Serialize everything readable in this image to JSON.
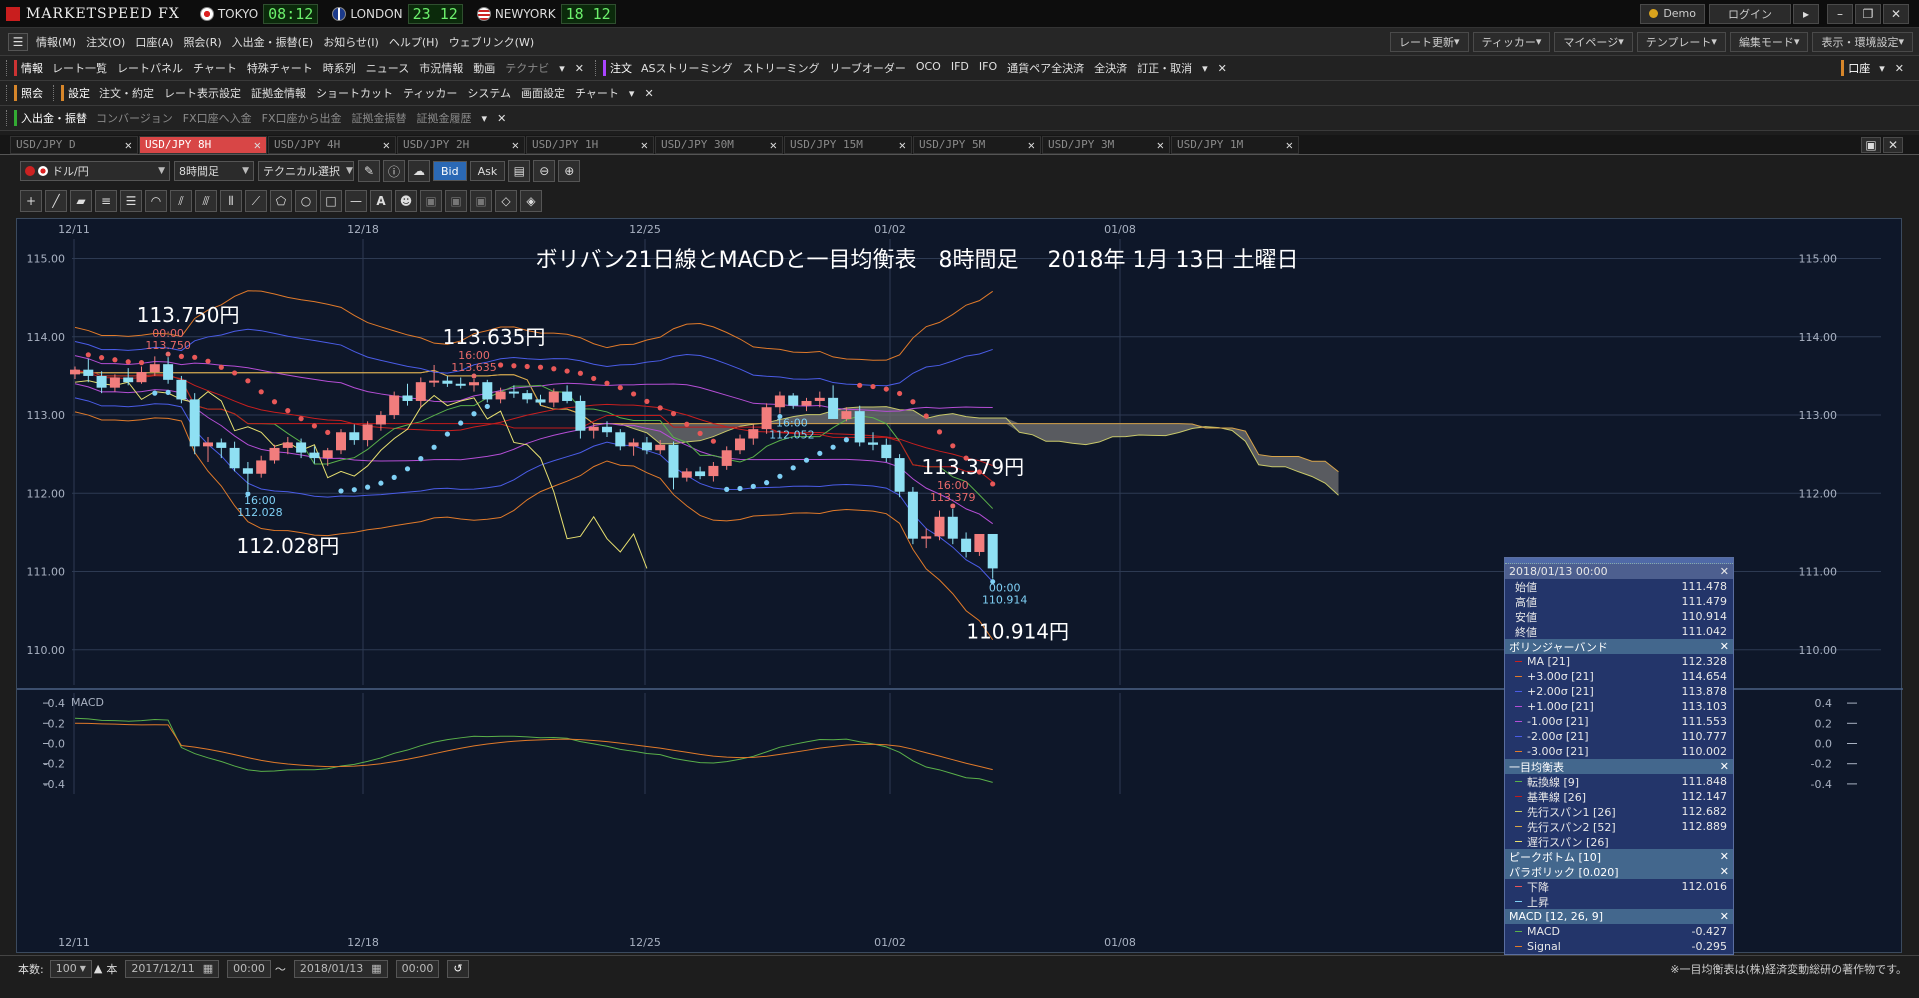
{
  "app": {
    "title": "MARKETSPEED FX"
  },
  "clocks": [
    {
      "city": "TOKYO",
      "time": "08:12"
    },
    {
      "city": "LONDON",
      "time": "23 12"
    },
    {
      "city": "NEWYORK",
      "time": "18 12"
    }
  ],
  "titlebar": {
    "demo": "Demo",
    "login": "ログイン"
  },
  "menu": [
    "情報(M)",
    "注文(O)",
    "口座(A)",
    "照会(R)",
    "入出金・振替(E)",
    "お知らせ(I)",
    "ヘルプ(H)",
    "ウェブリンク(W)"
  ],
  "menu_right": [
    "レート更新",
    "ティッカー",
    "マイページ",
    "テンプレート",
    "編集モード",
    "表示・環境設定"
  ],
  "toolbar1": {
    "info_label": "情報",
    "info_items": [
      "レート一覧",
      "レートパネル",
      "チャート",
      "特殊チャート",
      "時系列",
      "ニュース",
      "市況情報",
      "動画",
      "テクナビ"
    ],
    "order_label": "注文",
    "order_items": [
      "ASストリーミング",
      "ストリーミング",
      "リーブオーダー",
      "OCO",
      "IFD",
      "IFO",
      "通貨ペア全決済",
      "全決済",
      "訂正・取消"
    ],
    "right_label": "口座"
  },
  "toolbar2": {
    "account_label": "照会",
    "settings_label": "設定",
    "settings_items": [
      "注文・約定",
      "レート表示設定",
      "証拠金情報",
      "ショートカット",
      "ティッカー",
      "システム",
      "画面設定",
      "チャート"
    ]
  },
  "toolbar3": {
    "deposit_label": "入出金・振替",
    "deposit_items": [
      "コンバージョン",
      "FX口座へ入金",
      "FX口座から出金",
      "証拠金振替",
      "証拠金履歴"
    ]
  },
  "tabs": [
    "USD/JPY D",
    "USD/JPY 8H",
    "USD/JPY 4H",
    "USD/JPY 2H",
    "USD/JPY 1H",
    "USD/JPY 30M",
    "USD/JPY 15M",
    "USD/JPY 5M",
    "USD/JPY 3M",
    "USD/JPY 1M"
  ],
  "active_tab": 1,
  "controls": {
    "currency": "ドル/円",
    "period": "8時間足",
    "technical": "テクニカル選択",
    "bid": "Bid",
    "ask": "Ask"
  },
  "chart_data": {
    "type": "candlestick",
    "title": "ボリバン21日線とMACDと一目均衡表　8時間足　 2018年 1月 13日 土曜日",
    "x_labels": [
      "12/11",
      "12/18",
      "12/25",
      "01/02",
      "01/08"
    ],
    "y_ticks": [
      "115.00",
      "114.00",
      "113.00",
      "112.00",
      "111.00",
      "110.00"
    ],
    "ylim": [
      109.55,
      115.25
    ],
    "grid": true,
    "annotations": [
      {
        "text": "113.750円",
        "time": "00:00",
        "value": "113.750"
      },
      {
        "text": "113.635円",
        "time": "16:00",
        "value": "113.635"
      },
      {
        "text": "113.379円",
        "time": "16:00",
        "value": "113.379"
      },
      {
        "text": "112.028円",
        "time": "16:00",
        "value": "112.028"
      },
      {
        "text": "",
        "time": "16:00",
        "value": "112.052"
      },
      {
        "text": "110.914円",
        "time": "00:00",
        "value": "110.914"
      }
    ],
    "candles_ohlc": [
      [
        113.52,
        113.62,
        113.46,
        113.58
      ],
      [
        113.58,
        113.72,
        113.42,
        113.5
      ],
      [
        113.5,
        113.56,
        113.28,
        113.35
      ],
      [
        113.35,
        113.52,
        113.3,
        113.48
      ],
      [
        113.48,
        113.6,
        113.38,
        113.42
      ],
      [
        113.42,
        113.62,
        113.4,
        113.55
      ],
      [
        113.55,
        113.75,
        113.5,
        113.65
      ],
      [
        113.65,
        113.74,
        113.4,
        113.45
      ],
      [
        113.45,
        113.5,
        113.15,
        113.2
      ],
      [
        113.2,
        113.28,
        112.5,
        112.6
      ],
      [
        112.6,
        112.72,
        112.4,
        112.65
      ],
      [
        112.65,
        112.7,
        112.45,
        112.58
      ],
      [
        112.58,
        112.66,
        112.28,
        112.32
      ],
      [
        112.32,
        112.4,
        112.03,
        112.25
      ],
      [
        112.25,
        112.48,
        112.2,
        112.42
      ],
      [
        112.42,
        112.62,
        112.38,
        112.58
      ],
      [
        112.58,
        112.72,
        112.5,
        112.65
      ],
      [
        112.65,
        112.7,
        112.45,
        112.52
      ],
      [
        112.52,
        112.6,
        112.38,
        112.45
      ],
      [
        112.45,
        112.58,
        112.35,
        112.55
      ],
      [
        112.55,
        112.82,
        112.5,
        112.78
      ],
      [
        112.78,
        112.88,
        112.62,
        112.68
      ],
      [
        112.68,
        112.92,
        112.6,
        112.88
      ],
      [
        112.88,
        113.05,
        112.8,
        113.0
      ],
      [
        113.0,
        113.3,
        112.95,
        113.25
      ],
      [
        113.25,
        113.4,
        113.12,
        113.18
      ],
      [
        113.18,
        113.48,
        113.1,
        113.42
      ],
      [
        113.42,
        113.64,
        113.36,
        113.44
      ],
      [
        113.44,
        113.5,
        113.36,
        113.4
      ],
      [
        113.4,
        113.48,
        113.34,
        113.38
      ],
      [
        113.38,
        113.46,
        113.3,
        113.42
      ],
      [
        113.42,
        113.45,
        113.16,
        113.2
      ],
      [
        113.2,
        113.35,
        113.15,
        113.3
      ],
      [
        113.3,
        113.38,
        113.22,
        113.28
      ],
      [
        113.28,
        113.32,
        113.15,
        113.2
      ],
      [
        113.2,
        113.26,
        113.12,
        113.16
      ],
      [
        113.16,
        113.34,
        113.1,
        113.3
      ],
      [
        113.3,
        113.38,
        113.15,
        113.18
      ],
      [
        113.18,
        113.25,
        112.7,
        112.8
      ],
      [
        112.8,
        112.9,
        112.7,
        112.85
      ],
      [
        112.85,
        112.92,
        112.72,
        112.78
      ],
      [
        112.78,
        112.82,
        112.55,
        112.6
      ],
      [
        112.6,
        112.7,
        112.48,
        112.65
      ],
      [
        112.65,
        112.72,
        112.5,
        112.55
      ],
      [
        112.55,
        112.68,
        112.5,
        112.62
      ],
      [
        112.62,
        112.66,
        112.05,
        112.2
      ],
      [
        112.2,
        112.32,
        112.15,
        112.28
      ],
      [
        112.28,
        112.34,
        112.18,
        112.22
      ],
      [
        112.22,
        112.4,
        112.15,
        112.35
      ],
      [
        112.35,
        112.6,
        112.3,
        112.55
      ],
      [
        112.55,
        112.75,
        112.5,
        112.7
      ],
      [
        112.7,
        112.88,
        112.62,
        112.82
      ],
      [
        112.82,
        113.15,
        112.76,
        113.1
      ],
      [
        113.1,
        113.3,
        113.02,
        113.25
      ],
      [
        113.25,
        113.28,
        113.08,
        113.12
      ],
      [
        113.12,
        113.22,
        113.05,
        113.18
      ],
      [
        113.18,
        113.3,
        113.1,
        113.22
      ],
      [
        113.22,
        113.38,
        113.15,
        112.95
      ],
      [
        112.95,
        113.1,
        112.92,
        113.05
      ],
      [
        113.05,
        113.12,
        112.6,
        112.65
      ],
      [
        112.65,
        112.78,
        112.55,
        112.62
      ],
      [
        112.62,
        112.7,
        112.4,
        112.45
      ],
      [
        112.45,
        112.5,
        111.95,
        112.02
      ],
      [
        112.02,
        112.08,
        111.35,
        111.42
      ],
      [
        111.42,
        111.55,
        111.3,
        111.45
      ],
      [
        111.45,
        111.78,
        111.4,
        111.7
      ],
      [
        111.7,
        111.8,
        111.35,
        111.42
      ],
      [
        111.42,
        111.5,
        111.18,
        111.25
      ],
      [
        111.25,
        111.48,
        111.2,
        111.48
      ],
      [
        111.48,
        111.48,
        110.91,
        111.04
      ]
    ],
    "macd_ylim": [
      -0.5,
      0.5
    ],
    "macd_ticks": [
      "0.4",
      "0.2",
      "0.0",
      "-0.2",
      "-0.4"
    ],
    "macd_label": "MACD"
  },
  "info_panel": {
    "date": "2018/01/13 00:00",
    "ohlc": [
      {
        "label": "始値",
        "value": "111.478"
      },
      {
        "label": "高値",
        "value": "111.479"
      },
      {
        "label": "安値",
        "value": "110.914"
      },
      {
        "label": "終値",
        "value": "111.042"
      }
    ],
    "bb_title": "ボリンジャーバンド",
    "bb": [
      {
        "label": "MA [21]",
        "value": "112.328",
        "color": "#c81f1f"
      },
      {
        "label": "+3.00σ [21]",
        "value": "114.654",
        "color": "#e07a2a"
      },
      {
        "label": "+2.00σ [21]",
        "value": "113.878",
        "color": "#4a5ce6"
      },
      {
        "label": "+1.00σ [21]",
        "value": "113.103",
        "color": "#b54ed6"
      },
      {
        "label": "-1.00σ [21]",
        "value": "111.553",
        "color": "#b54ed6"
      },
      {
        "label": "-2.00σ [21]",
        "value": "110.777",
        "color": "#4a5ce6"
      },
      {
        "label": "-3.00σ [21]",
        "value": "110.002",
        "color": "#e07a2a"
      }
    ],
    "ichimoku_title": "一目均衡表",
    "ichimoku": [
      {
        "label": "転換線 [9]",
        "value": "111.848",
        "color": "#5ab04a"
      },
      {
        "label": "基準線 [26]",
        "value": "112.147",
        "color": "#c21b1b"
      },
      {
        "label": "先行スパン1 [26]",
        "value": "112.682",
        "color": "#c8c86a"
      },
      {
        "label": "先行スパン2 [52]",
        "value": "112.889",
        "color": "#d7a44a"
      },
      {
        "label": "遅行スパン [26]",
        "value": "",
        "color": "#e8e070"
      }
    ],
    "peak_title": "ピークボトム [10]",
    "psar_title": "パラボリック [0.020]",
    "psar": [
      {
        "label": "下降",
        "value": "112.016",
        "color": "#e85858"
      },
      {
        "label": "上昇",
        "value": "",
        "color": "#7fd0f5"
      }
    ],
    "macd_title": "MACD [12, 26, 9]",
    "macd": [
      {
        "label": "MACD",
        "value": "-0.427",
        "color": "#5ab04a"
      },
      {
        "label": "Signal",
        "value": "-0.295",
        "color": "#e07a2a"
      }
    ]
  },
  "statusbar": {
    "count_label": "本数:",
    "count": "100",
    "unit": "本",
    "from_date": "2017/12/11",
    "from_time": "00:00",
    "tilde": "〜",
    "to_date": "2018/01/13",
    "to_time": "00:00",
    "copyright": "※一目均衡表は(株)経済変動総研の著作物です。"
  },
  "colors": {
    "bull": "#f27d7d",
    "bear": "#8fe0f3",
    "cloud": "#6b6b6b",
    "accent": "#d84646"
  }
}
